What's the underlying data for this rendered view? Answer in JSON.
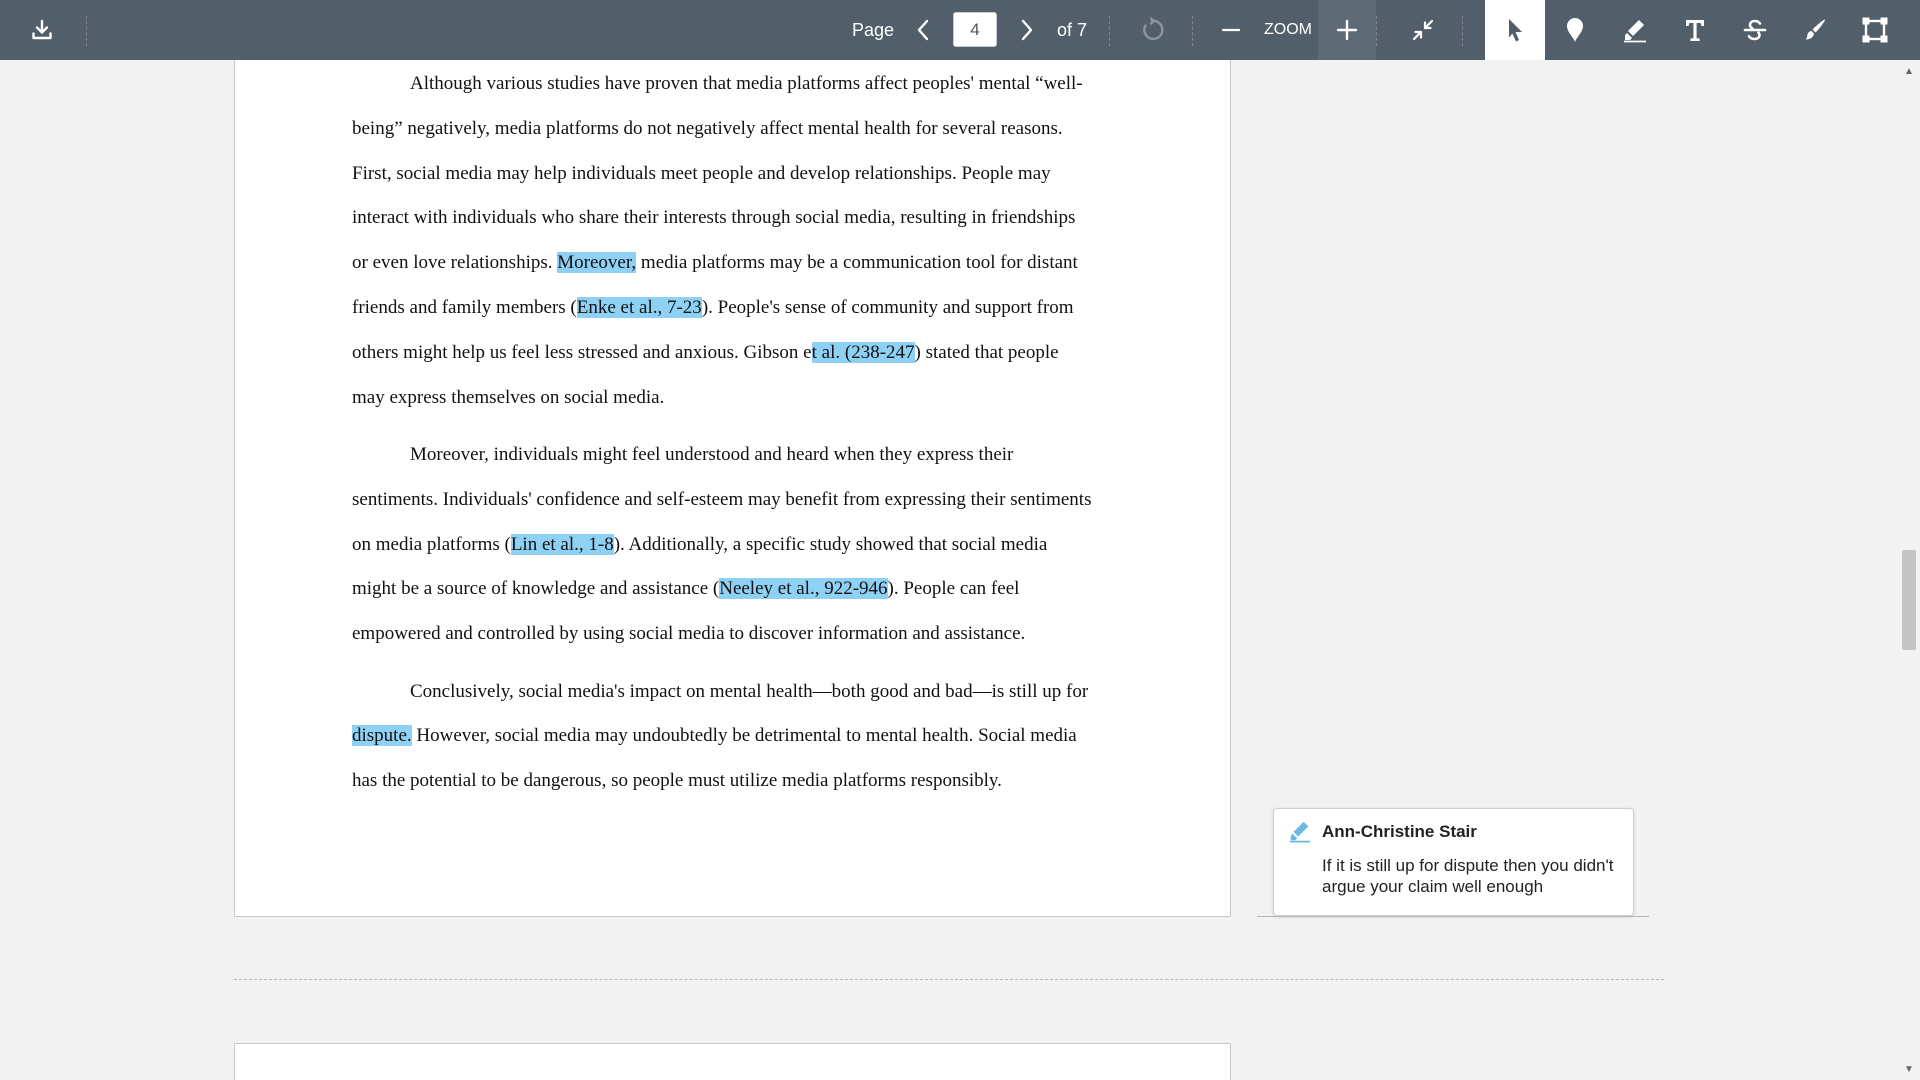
{
  "toolbar": {
    "page_label": "Page",
    "page_value": "4",
    "page_total": "of 7",
    "zoom_label": "ZOOM",
    "icons": [
      "download-icon",
      "chevron-left-icon",
      "chevron-right-icon",
      "rotate-icon",
      "zoom-out-icon",
      "zoom-in-icon",
      "collapse-icon",
      "select-cursor-icon",
      "pin-icon",
      "highlighter-icon",
      "text-icon",
      "strikethrough-icon",
      "brush-icon",
      "area-select-icon"
    ],
    "colors": {
      "bar": "#525e6a",
      "highlight": "#8fd0f5"
    }
  },
  "document": {
    "paragraphs": [
      {
        "lines": [
          [
            {
              "t": "Although various studies have proven that media platforms affect peoples' mental “well-"
            }
          ],
          [
            {
              "t": "being” negatively, media platforms do not negatively affect mental health for several reasons."
            }
          ],
          [
            {
              "t": "First, social media may help individuals meet people and develop relationships. People may"
            }
          ],
          [
            {
              "t": "interact with individuals who share their interests through social media, resulting in friendships"
            }
          ],
          [
            {
              "t": "or even love relationships. "
            },
            {
              "t": "Moreover,",
              "hl": true
            },
            {
              "t": " media platforms may be a communication tool for distant"
            }
          ],
          [
            {
              "t": "friends and family members ("
            },
            {
              "t": "Enke et al., 7-23",
              "hl": true
            },
            {
              "t": "). People's sense of community and support from"
            }
          ],
          [
            {
              "t": "others might help us feel less stressed and anxious. Gibson e"
            },
            {
              "t": "t al. (238-247",
              "hl": true
            },
            {
              "t": ") stated that people"
            }
          ],
          [
            {
              "t": "may express themselves on social media."
            }
          ]
        ]
      },
      {
        "lines": [
          [
            {
              "t": "Moreover, individuals might feel understood and heard when they express their"
            }
          ],
          [
            {
              "t": "sentiments. Individuals' confidence and self-esteem may benefit from expressing their sentiments"
            }
          ],
          [
            {
              "t": "on media platforms ("
            },
            {
              "t": "Lin et al., 1-8",
              "hl": true
            },
            {
              "t": "). Additionally, a specific study showed that social media"
            }
          ],
          [
            {
              "t": "might be a source of knowledge and assistance ("
            },
            {
              "t": "Neeley et al., 922-946",
              "hl": true
            },
            {
              "t": "). People can feel"
            }
          ],
          [
            {
              "t": "empowered and controlled by using social media to discover information and assistance."
            }
          ]
        ]
      },
      {
        "lines": [
          [
            {
              "t": "Conclusively, social media's impact on mental health—both good and bad—is still up for"
            }
          ],
          [
            {
              "t": "dispute.",
              "hl": true
            },
            {
              "t": " However, social media may undoubtedly be detrimental to mental health. Social media"
            }
          ],
          [
            {
              "t": "has the potential to be dangerous, so people must utilize media platforms responsibly."
            }
          ]
        ]
      }
    ]
  },
  "comment": {
    "author": "Ann-Christine Stair",
    "text": "If it is still up for dispute then you didn't argue your claim well enough",
    "icon": "highlighter-icon"
  }
}
